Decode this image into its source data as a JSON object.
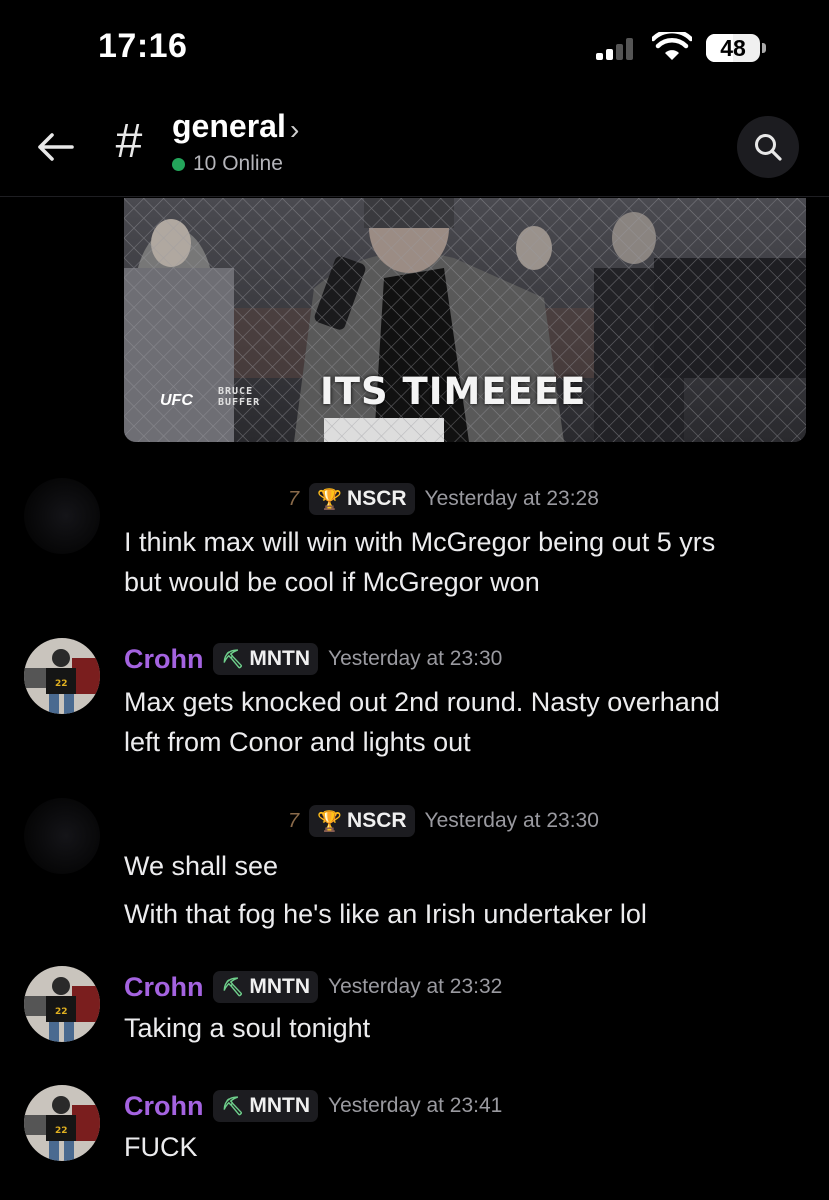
{
  "status_bar": {
    "time": "17:16",
    "battery": "48"
  },
  "header": {
    "channel_name": "general",
    "online": "10 Online"
  },
  "gif": {
    "caption": "ITS TIMEEEE",
    "logo": "UFC",
    "tag_line1": "BRUCE",
    "tag_line2": "BUFFER"
  },
  "messages": [
    {
      "author": "",
      "role": "NSCR",
      "prefix": "7",
      "timestamp": "Yesterday at 23:28",
      "lines": [
        "I think max will win with McGregor being out 5 yrs",
        "but would be cool if McGregor won"
      ]
    },
    {
      "author": "Crohn",
      "role": "MNTN",
      "timestamp": "Yesterday at 23:30",
      "lines": [
        "Max gets knocked out 2nd round. Nasty overhand",
        "left from Conor and lights out"
      ]
    },
    {
      "author": "",
      "role": "NSCR",
      "prefix": "7",
      "timestamp": "Yesterday at 23:30",
      "lines": [
        "We shall see",
        "With that fog he's like an Irish undertaker lol"
      ]
    },
    {
      "author": "Crohn",
      "role": "MNTN",
      "timestamp": "Yesterday at 23:32",
      "lines": [
        "Taking a soul tonight"
      ]
    },
    {
      "author": "Crohn",
      "role": "MNTN",
      "timestamp": "Yesterday at 23:41",
      "lines": [
        "FUCK"
      ]
    }
  ],
  "colors": {
    "accent": "#a463e0",
    "online": "#23a55a",
    "background": "#000000"
  }
}
